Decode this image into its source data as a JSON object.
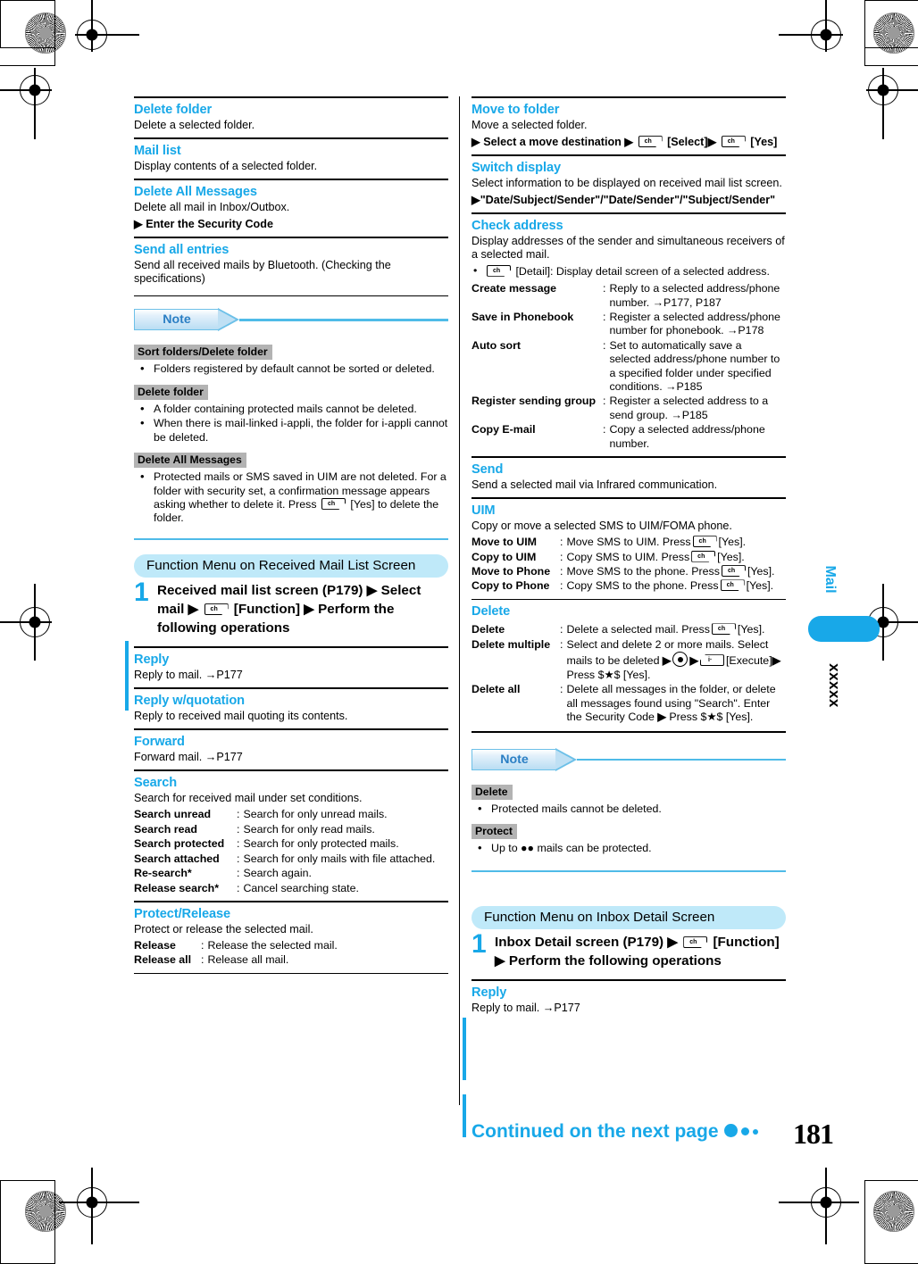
{
  "page": {
    "number": "181",
    "continued": "Continued on the next page"
  },
  "side_tab": {
    "label": "Mail",
    "code": "xxxxx"
  },
  "icons": {
    "key_function": "function-key-icon",
    "key_execute": "execute-key-icon",
    "center_select": "center-select-key-icon",
    "arrow": "▶"
  },
  "left_column": {
    "sections": [
      {
        "title": "Delete folder",
        "body": "Delete a selected folder."
      },
      {
        "title": "Mail list",
        "body": "Display contents of a selected folder."
      },
      {
        "title": "Delete All Messages",
        "body": "Delete all mail in Inbox/Outbox.",
        "step": "Enter the Security Code"
      },
      {
        "title": "Send all entries",
        "body": "Send all received mails by Bluetooth. (Checking the specifications)"
      }
    ],
    "note": {
      "banner": "Note",
      "groups": [
        {
          "label": "Sort folders/Delete folder",
          "bullets": [
            "Folders registered by default cannot be sorted or deleted."
          ]
        },
        {
          "label": "Delete folder",
          "bullets": [
            "A folder containing protected mails cannot be deleted.",
            "When there is mail-linked i-appli, the folder for i-appli cannot be deleted."
          ]
        },
        {
          "label": "Delete All Messages",
          "bullets": [
            "Protected mails or SMS saved in UIM are not deleted. For a folder with security set, a confirmation message appears asking whether to delete it. Press"
          ],
          "bullet_tail": "[Yes] to delete the folder."
        }
      ]
    },
    "function_menu": {
      "pill": "Function Menu on Received Mail List Screen",
      "step_number": "1",
      "step_part1": "Received mail list screen (P179)",
      "step_part2": "Select mail",
      "step_part3": "[Function]",
      "step_part4": "Perform the following operations"
    },
    "sections2": [
      {
        "title": "Reply",
        "body": "Reply to mail. →P177"
      },
      {
        "title": "Reply w/quotation",
        "body": "Reply to received mail quoting its contents."
      },
      {
        "title": "Forward",
        "body": "Forward mail. →P177"
      }
    ],
    "search": {
      "title": "Search",
      "body": "Search for received mail under set conditions.",
      "rows": [
        {
          "label": "Search unread",
          "desc": "Search for only unread mails."
        },
        {
          "label": "Search read",
          "desc": "Search for only read mails."
        },
        {
          "label": "Search protected",
          "desc": "Search for only protected mails."
        },
        {
          "label": "Search attached",
          "desc": "Search for only mails with file attached."
        },
        {
          "label": "Re-search*",
          "desc": "Search again."
        },
        {
          "label": "Release search*",
          "desc": "Cancel searching state."
        }
      ]
    },
    "protect": {
      "title": "Protect/Release",
      "body": "Protect or release the selected mail.",
      "rows": [
        {
          "label": "Release",
          "desc": "Release the selected mail."
        },
        {
          "label": "Release all",
          "desc": "Release all mail."
        }
      ]
    }
  },
  "right_column": {
    "move_to_folder": {
      "title": "Move to folder",
      "body": "Move a selected folder.",
      "step_part1": "Select a move destination",
      "step_part2": "[Select]",
      "step_part3": "[Yes]"
    },
    "switch_display": {
      "title": "Switch display",
      "body": "Select information to be displayed on received mail list screen.",
      "step": "\"Date/Subject/Sender\"/\"Date/Sender\"/\"Subject/Sender\""
    },
    "check_address": {
      "title": "Check address",
      "body": "Display addresses of the sender and simultaneous receivers of a selected mail.",
      "bullet": "[Detail]: Display detail screen of a selected address.",
      "rows": [
        {
          "label": "Create message",
          "desc": "Reply to a selected address/phone number. →P177, P187"
        },
        {
          "label": "Save in Phonebook",
          "desc": "Register a selected address/phone number for phonebook. →P178"
        },
        {
          "label": "Auto sort",
          "desc": "Set to automatically save a selected address/phone number to a specified folder under specified conditions. →P185"
        },
        {
          "label": "Register sending group",
          "desc": "Register a selected address to a send group. →P185"
        },
        {
          "label": "Copy E-mail",
          "desc": "Copy a selected address/phone number."
        }
      ]
    },
    "send": {
      "title": "Send",
      "body": "Send a selected mail via Infrared communication."
    },
    "uim": {
      "title": "UIM",
      "body": "Copy or move a selected SMS to UIM/FOMA phone.",
      "rows": [
        {
          "label": "Move to UIM",
          "pre": "Move SMS to UIM. Press",
          "post": "[Yes]."
        },
        {
          "label": "Copy to UIM",
          "pre": "Copy SMS to UIM. Press",
          "post": "[Yes]."
        },
        {
          "label": "Move to Phone",
          "pre": "Move SMS to the phone. Press",
          "post": "[Yes]."
        },
        {
          "label": "Copy to Phone",
          "pre": "Copy SMS to the phone. Press",
          "post": "[Yes]."
        }
      ]
    },
    "delete": {
      "title": "Delete",
      "rows": [
        {
          "label": "Delete",
          "pre": "Delete a selected mail. Press",
          "post": "[Yes]."
        },
        {
          "label": "Delete multiple",
          "pre": "Select and delete 2 or more mails. Select mails to be deleted",
          "mid": "[Execute]",
          "post": "Press $★$ [Yes]."
        },
        {
          "label": "Delete all",
          "pre": "Delete all messages in the folder, or delete all messages found using \"Search\". Enter the Security Code",
          "post": "Press $★$ [Yes]."
        }
      ]
    },
    "note": {
      "banner": "Note",
      "groups": [
        {
          "label": "Delete",
          "bullets": [
            "Protected mails cannot be deleted."
          ]
        },
        {
          "label": "Protect",
          "bullets": [
            "Up to ●● mails can be protected."
          ]
        }
      ]
    },
    "function_menu": {
      "pill": "Function Menu on Inbox Detail Screen",
      "step_number": "1",
      "step_part1": "Inbox Detail screen (P179)",
      "step_part2": "[Function]",
      "step_part3": "Perform the following operations"
    },
    "reply": {
      "title": "Reply",
      "body": "Reply to mail. →P177"
    }
  }
}
